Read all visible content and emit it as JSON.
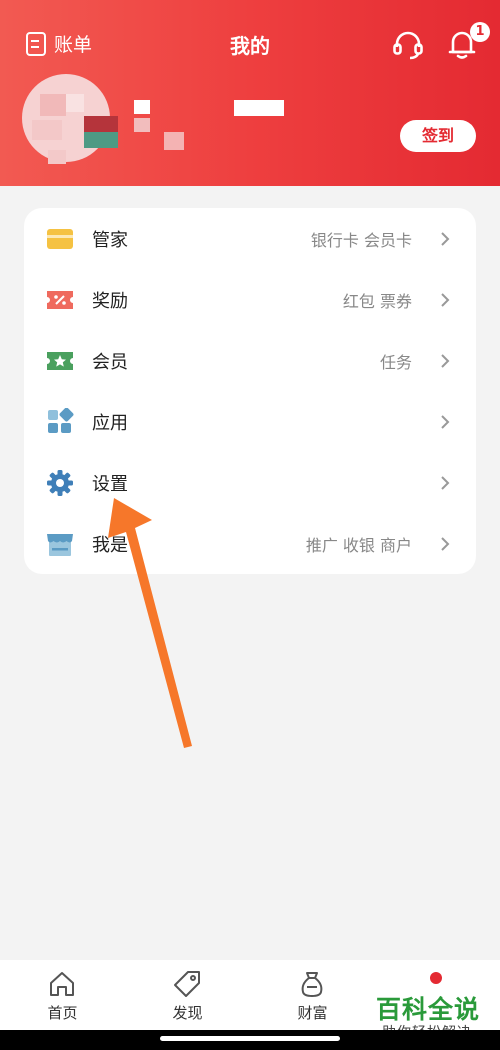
{
  "header": {
    "ledger_label": "账单",
    "title": "我的",
    "notification_count": "1",
    "sign_in_label": "签到"
  },
  "menu": {
    "items": [
      {
        "label": "管家",
        "sub": "银行卡 会员卡",
        "icon": "card-icon"
      },
      {
        "label": "奖励",
        "sub": "红包 票券",
        "icon": "coupon-icon"
      },
      {
        "label": "会员",
        "sub": "任务",
        "icon": "member-ticket-icon"
      },
      {
        "label": "应用",
        "sub": "",
        "icon": "apps-grid-icon"
      },
      {
        "label": "设置",
        "sub": "",
        "icon": "gear-icon"
      },
      {
        "label": "我是",
        "sub": "推广 收银 商户",
        "icon": "shop-icon"
      }
    ]
  },
  "bottom_nav": {
    "items": [
      {
        "label": "首页",
        "icon": "home-icon"
      },
      {
        "label": "发现",
        "icon": "tag-icon"
      },
      {
        "label": "财富",
        "icon": "money-bag-icon"
      },
      {
        "label": "",
        "icon": "profile-icon"
      }
    ]
  },
  "watermark": {
    "main": "百科全说",
    "sub": "助你轻松解决"
  },
  "colors": {
    "brand_red": "#e42a32",
    "card_yellow": "#f5c242",
    "coupon_red": "#ef6a5e",
    "member_green": "#4aa05e",
    "apps_blue": "#5b9bc4",
    "gear_blue": "#3f7fb8",
    "arrow_orange": "#f6772a"
  }
}
